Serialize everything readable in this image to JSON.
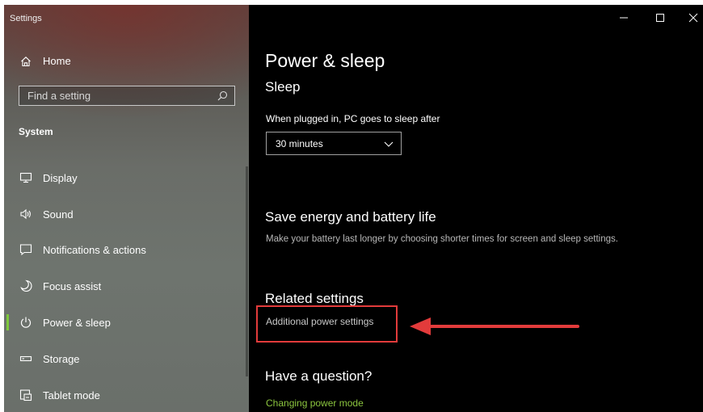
{
  "window": {
    "title": "Settings",
    "controls": [
      "minimize-icon",
      "maximize-icon",
      "close-icon"
    ]
  },
  "sidebar": {
    "home_label": "Home",
    "search_placeholder": "Find a setting",
    "section_label": "System",
    "items": [
      {
        "label": "Display",
        "icon": "display-icon"
      },
      {
        "label": "Sound",
        "icon": "sound-icon"
      },
      {
        "label": "Notifications & actions",
        "icon": "notifications-icon"
      },
      {
        "label": "Focus assist",
        "icon": "moon-icon"
      },
      {
        "label": "Power & sleep",
        "icon": "power-icon",
        "active": true
      },
      {
        "label": "Storage",
        "icon": "storage-icon"
      },
      {
        "label": "Tablet mode",
        "icon": "tablet-icon"
      }
    ]
  },
  "main": {
    "title": "Power & sleep",
    "sleep_heading": "Sleep",
    "sleep_label": "When plugged in, PC goes to sleep after",
    "sleep_value": "30 minutes",
    "save_heading": "Save energy and battery life",
    "save_desc": "Make your battery last longer by choosing shorter times for screen and sleep settings.",
    "related_heading": "Related settings",
    "related_link": "Additional power settings",
    "question_heading": "Have a question?",
    "question_link": "Changing power mode"
  },
  "colors": {
    "accent_green": "#8cc63f",
    "annotation_red": "#e23b3b"
  }
}
